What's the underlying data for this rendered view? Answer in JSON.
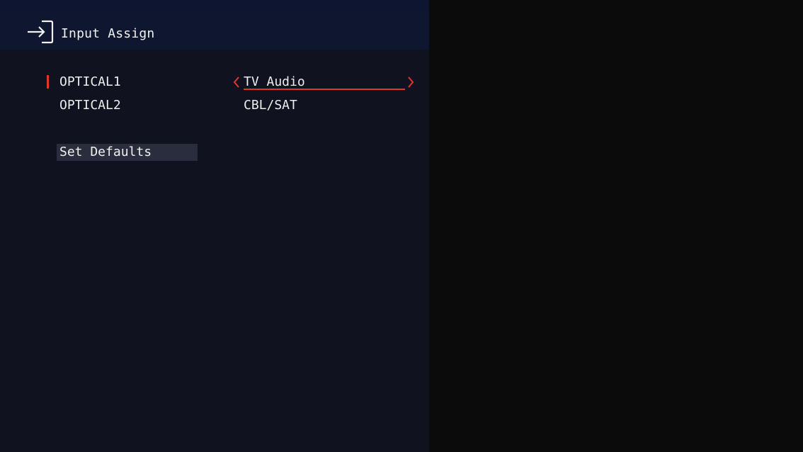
{
  "header": {
    "icon": "input-icon",
    "title": "Input Assign"
  },
  "rows": [
    {
      "label": "OPTICAL1",
      "value": "TV Audio",
      "selected": true
    },
    {
      "label": "OPTICAL2",
      "value": "CBL/SAT",
      "selected": false
    }
  ],
  "actions": {
    "set_defaults_label": "Set Defaults"
  },
  "colors": {
    "accent": "#e2352c",
    "panel_background": "#10121f",
    "header_background": "#0f1730",
    "button_background": "#2a2d3d",
    "text": "#ededed"
  }
}
